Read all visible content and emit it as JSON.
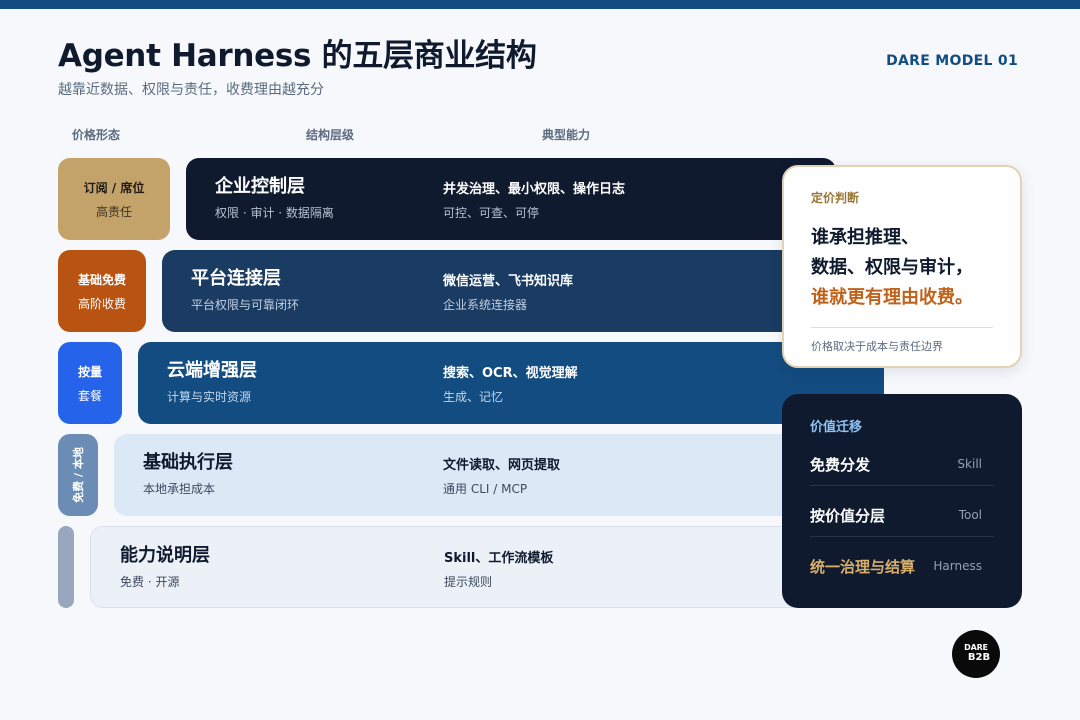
{
  "header": {
    "title": "Agent Harness 的五层商业结构",
    "subtitle": "越靠近数据、权限与责任，收费理由越充分",
    "model": "DARE MODEL 01"
  },
  "columns": {
    "pricing": "价格形态",
    "layer": "结构层级",
    "capability": "典型能力"
  },
  "pricing": [
    {
      "title": "订阅 / 席位",
      "sub": "高责任"
    },
    {
      "title": "基础免费",
      "sub": "高阶收费"
    },
    {
      "title": "按量",
      "sub": "套餐"
    },
    {
      "title": "免费 / 本地",
      "sub": ""
    },
    {
      "title": "",
      "sub": ""
    }
  ],
  "layers": [
    {
      "name": "企业控制层",
      "sub": "权限 · 审计 · 数据隔离",
      "cap1": "并发治理、最小权限、操作日志",
      "cap2": "可控、可查、可停"
    },
    {
      "name": "平台连接层",
      "sub": "平台权限与可靠闭环",
      "cap1": "微信运营、飞书知识库",
      "cap2": "企业系统连接器"
    },
    {
      "name": "云端增强层",
      "sub": "计算与实时资源",
      "cap1": "搜索、OCR、视觉理解",
      "cap2": "生成、记忆"
    },
    {
      "name": "基础执行层",
      "sub": "本地承担成本",
      "cap1": "文件读取、网页提取",
      "cap2": "通用 CLI / MCP"
    },
    {
      "name": "能力说明层",
      "sub": "免费 · 开源",
      "cap1": "Skill、工作流模板",
      "cap2": "提示规则"
    }
  ],
  "judgement": {
    "heading": "定价判断",
    "line1": "谁承担推理、",
    "line2": "数据、权限与审计，",
    "line3": "谁就更有理由收费。",
    "note": "价格取决于成本与责任边界"
  },
  "shift": {
    "heading": "价值迁移",
    "rows": [
      {
        "label": "免费分发",
        "tag": "Skill"
      },
      {
        "label": "按价值分层",
        "tag": "Tool"
      },
      {
        "label": "统一治理与结算",
        "tag": "Harness"
      }
    ]
  },
  "badge": {
    "line1": "DARE",
    "line2": "B2B"
  },
  "colors": {
    "accent_blue": "#124c80",
    "gold": "#c4a36a",
    "orange": "#b95311",
    "bright_blue": "#2563eb",
    "slate": "#6b8cb4",
    "grey": "#98a7bd",
    "navy": "#0f1a2e",
    "highlight": "#c0621a"
  }
}
